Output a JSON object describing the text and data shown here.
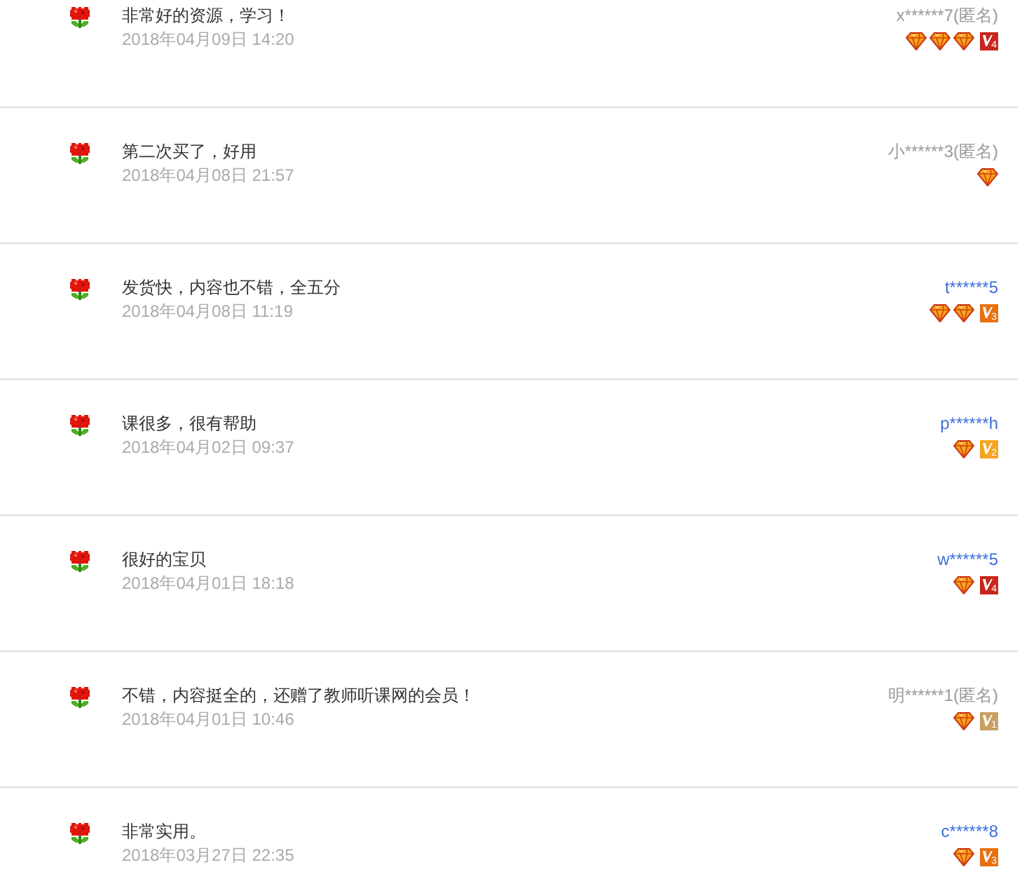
{
  "reviews": [
    {
      "text": "非常好的资源，学习！",
      "date": "2018年04月09日 14:20",
      "user": "x******7(匿名)",
      "anonymous": true,
      "rank_icons": [
        {
          "kind": "diamond"
        },
        {
          "kind": "diamond"
        },
        {
          "kind": "diamond"
        },
        {
          "kind": "level",
          "label": "4",
          "color": "#c8261c"
        }
      ]
    },
    {
      "text": "第二次买了，好用",
      "date": "2018年04月08日 21:57",
      "user": "小******3(匿名)",
      "anonymous": true,
      "rank_icons": [
        {
          "kind": "diamond"
        }
      ]
    },
    {
      "text": "发货快，内容也不错，全五分",
      "date": "2018年04月08日 11:19",
      "user": "t******5",
      "anonymous": false,
      "rank_icons": [
        {
          "kind": "diamond"
        },
        {
          "kind": "diamond"
        },
        {
          "kind": "level",
          "label": "3",
          "color": "#e8700f"
        }
      ]
    },
    {
      "text": "课很多，很有帮助",
      "date": "2018年04月02日 09:37",
      "user": "p******h",
      "anonymous": false,
      "rank_icons": [
        {
          "kind": "diamond"
        },
        {
          "kind": "level",
          "label": "2",
          "color": "#f5a51f"
        }
      ]
    },
    {
      "text": "很好的宝贝",
      "date": "2018年04月01日 18:18",
      "user": "w******5",
      "anonymous": false,
      "rank_icons": [
        {
          "kind": "diamond"
        },
        {
          "kind": "level",
          "label": "4",
          "color": "#c8261c"
        }
      ]
    },
    {
      "text": "不错，内容挺全的，还赠了教师听课网的会员！",
      "date": "2018年04月01日 10:46",
      "user": "明******1(匿名)",
      "anonymous": true,
      "rank_icons": [
        {
          "kind": "diamond"
        },
        {
          "kind": "level",
          "label": "1",
          "color": "#c8a064"
        }
      ]
    },
    {
      "text": "非常实用。",
      "date": "2018年03月27日 22:35",
      "user": "c******8",
      "anonymous": false,
      "rank_icons": [
        {
          "kind": "diamond"
        },
        {
          "kind": "level",
          "label": "3",
          "color": "#e8700f"
        }
      ]
    }
  ]
}
